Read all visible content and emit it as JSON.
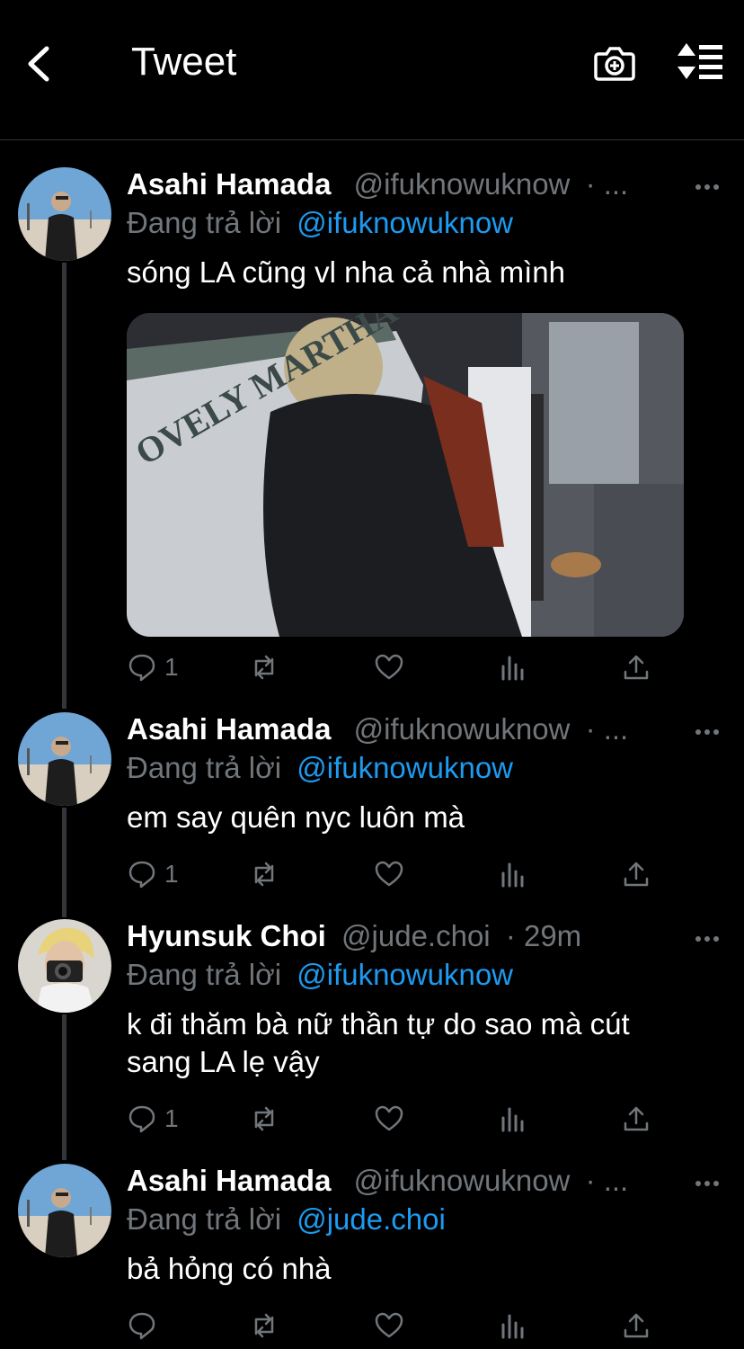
{
  "header": {
    "title": "Tweet",
    "back_icon": "chevron-left-icon",
    "camera_icon": "camera-plus-icon",
    "sort_icon": "sort-icon"
  },
  "colors": {
    "background": "#000000",
    "link": "#1d9bf0",
    "muted": "#71767b",
    "text": "#ffffff"
  },
  "tweets": [
    {
      "name": "Asahi Hamada",
      "handle": "@ifuknowuknow",
      "meta": "· ...",
      "reply_prefix": "Đang trả lời",
      "reply_to": "@ifuknowuknow",
      "text": "sóng LA cũng vl nha cả nhà mình",
      "has_media": true,
      "media_caption": "OVELY MARTHA",
      "reply_count": "1"
    },
    {
      "name": "Asahi Hamada",
      "handle": "@ifuknowuknow",
      "meta": "· ...",
      "reply_prefix": "Đang trả lời",
      "reply_to": "@ifuknowuknow",
      "text": "em say quên nyc luôn mà",
      "reply_count": "1"
    },
    {
      "name": "Hyunsuk Choi",
      "handle": "@jude.choi",
      "meta": "· 29m",
      "reply_prefix": "Đang trả lời",
      "reply_to": "@ifuknowuknow",
      "text": "k đi thăm bà nữ thần tự do sao mà cút sang LA lẹ vậy",
      "reply_count": "1"
    },
    {
      "name": "Asahi Hamada",
      "handle": "@ifuknowuknow",
      "meta": "· ...",
      "reply_prefix": "Đang trả lời",
      "reply_to": "@jude.choi",
      "text": "bả hỏng có nhà",
      "reply_count": ""
    }
  ]
}
